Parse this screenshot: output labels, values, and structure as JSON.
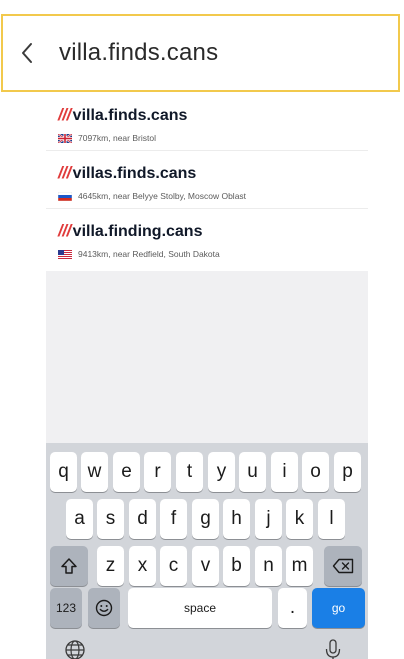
{
  "search": {
    "value": "villa.finds.cans"
  },
  "suggestions": [
    {
      "slashes": "///",
      "address": "villa.finds.cans",
      "distance": "7097km, near Bristol",
      "flag": "uk"
    },
    {
      "slashes": "///",
      "address": "villas.finds.cans",
      "distance": "4645km, near Belyye Stolby, Moscow Oblast",
      "flag": "ru"
    },
    {
      "slashes": "///",
      "address": "villa.finding.cans",
      "distance": "9413km, near Redfield, South Dakota",
      "flag": "us"
    }
  ],
  "keyboard": {
    "row1": [
      "q",
      "w",
      "e",
      "r",
      "t",
      "y",
      "u",
      "i",
      "o",
      "p"
    ],
    "row2": [
      "a",
      "s",
      "d",
      "f",
      "g",
      "h",
      "j",
      "k",
      "l"
    ],
    "row3": [
      "z",
      "x",
      "c",
      "v",
      "b",
      "n",
      "m"
    ],
    "numbers_label": "123",
    "space_label": "space",
    "dot_label": ".",
    "go_label": "go"
  },
  "colors": {
    "accent": "#f2c94c",
    "slashes": "#e03b3b",
    "go": "#1a7fe6"
  }
}
